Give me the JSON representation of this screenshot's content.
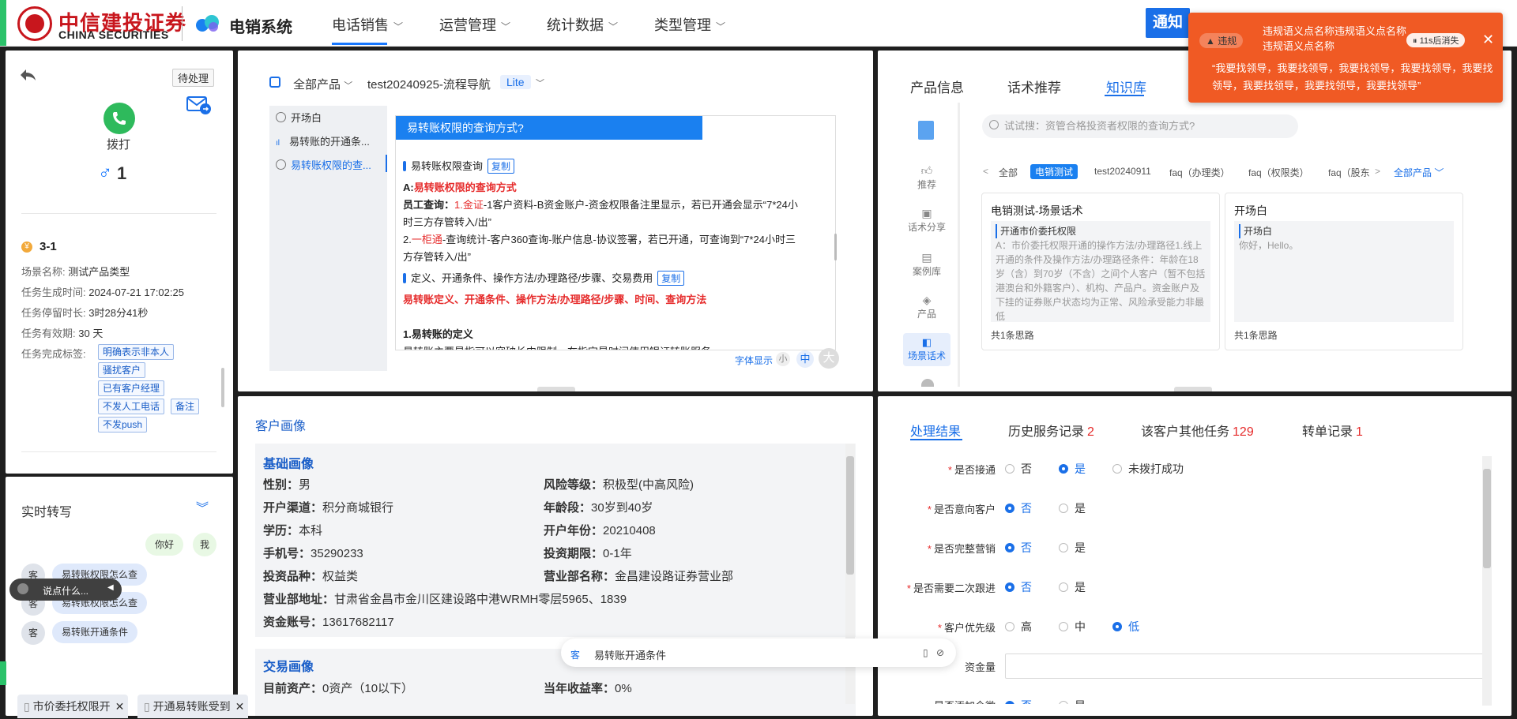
{
  "header": {
    "logo_cn": "中信建投证券",
    "logo_en": "CHINA SECURITIES",
    "system_name": "电销系统",
    "nav": [
      "电话销售",
      "运营管理",
      "统计数据",
      "类型管理"
    ],
    "notice_button": "通知"
  },
  "toast": {
    "badge": "违规",
    "title": "违规语义点名称违规语义点名称违规语义点名称",
    "timer": "11s后消失",
    "body": "“我要找领导，我要找领导，我要找领导，我要找领导，我要找领导，我要找领导，我要找领导，我要找领导”"
  },
  "customer_panel": {
    "pending_button": "待处理",
    "dial_label": "拨打",
    "gender_symbol": "♂",
    "count": "1",
    "task_id": "3-1",
    "fields": [
      {
        "label": "场景名称:",
        "value": "测试产品类型"
      },
      {
        "label": "任务生成时间:",
        "value": "2024-07-21 17:02:25"
      },
      {
        "label": "任务停留时长:",
        "value": "3时28分41秒"
      },
      {
        "label": "任务有效期:",
        "value": "30 天"
      },
      {
        "label": "任务完成标签:",
        "value": ""
      }
    ],
    "tags": [
      "明确表示非本人",
      "骚扰客户",
      "已有客户经理",
      "不发人工电话",
      "备注",
      "不发push"
    ]
  },
  "realtime": {
    "title": "实时转写",
    "messages": [
      {
        "side": "agent",
        "text": "你好",
        "avatar": "我"
      },
      {
        "side": "customer",
        "text": "易转账权限怎么查",
        "avatar": "客"
      },
      {
        "side": "customer",
        "text": "易转账权限怎么查",
        "avatar": "客"
      },
      {
        "side": "customer",
        "text": "易转账开通条件",
        "avatar": "客"
      }
    ],
    "voice_placeholder": "说点什么..."
  },
  "script_panel": {
    "product_select": "全部产品",
    "flow_name": "test20240925-流程导航",
    "lite_badge": "Lite",
    "flow_items": [
      "开场白",
      "易转账的开通条...",
      "易转账权限的查..."
    ],
    "content_title": "易转账权限的查询方式?",
    "section1_title": "易转账权限查询",
    "copy_label": "复制",
    "answer_head_prefix": "A:",
    "answer_head": "易转账权限的查询方式",
    "line1_label": "员工查询：",
    "line1_num": "1.",
    "line1_red": "金证",
    "line1_rest": "-1客户资料-B资金账户-资金权限备注里显示，若已开通会显示“7*24小",
    "line1_cont": "时三方存管转入/出”",
    "line2_num": "2.",
    "line2_red": "一柜通",
    "line2_rest": "-查询统计-客户360查询-账户信息-协议签署，若已开通，可查询到“7*24小时三",
    "line2_cont": "方存管转入/出”",
    "section2_title": "定义、开通条件、操作方法/办理路径/步骤、交易费用",
    "section2_red": "易转账定义、开通条件、操作方法/办理路径/步骤、时间、查询方法",
    "sub_heading": "1.易转账的定义",
    "sub_text": "易转账主要是指可以突破长中限制，在指定是时间使用银证转账服务",
    "font_size_label": "字体显示",
    "font_sizes": [
      "小",
      "中",
      "大"
    ]
  },
  "knowledge_panel": {
    "tabs": [
      "产品信息",
      "话术推荐",
      "知识库"
    ],
    "side_items": [
      "推荐",
      "话术分享",
      "案例库",
      "产品",
      "场景话术"
    ],
    "search_placeholder": "试试搜：资管合格投资者权限的查询方式?",
    "categories": [
      "全部",
      "电销测试",
      "test20240911",
      "faq（办理类）",
      "faq（权限类）",
      "faq（股东"
    ],
    "all_products": "全部产品",
    "cards": [
      {
        "title": "电销测试-场景话术",
        "sub": "开通市价委托权限",
        "body": "A：市价委托权限开通的操作方法/办理路径1.线上开通的条件及操作方法/办理路径条件：年龄在18岁（含）到70岁（不含）之间个人客户（暂不包括港澳台和外籍客户）、机构、产品户。资金账户及下挂的证券账户状态均为正常、风险承受能力非最低",
        "foot": "共1条思路"
      },
      {
        "title": "开场白",
        "sub": "开场白",
        "body": "你好，Hello。",
        "foot": "共1条思路"
      }
    ]
  },
  "portrait": {
    "title": "客户画像",
    "basic_title": "基础画像",
    "basic_left": [
      {
        "k": "性别：",
        "v": "男"
      },
      {
        "k": "开户渠道：",
        "v": "积分商城银行"
      },
      {
        "k": "学历：",
        "v": "本科"
      },
      {
        "k": "手机号：",
        "v": "35290233"
      },
      {
        "k": "投资品种：",
        "v": "权益类"
      },
      {
        "k": "营业部地址：",
        "v": "甘肃省金昌市金川区建设路中港WRMH零层5965、1839"
      },
      {
        "k": "资金账号：",
        "v": "13617682117"
      }
    ],
    "basic_right": [
      {
        "k": "风险等级：",
        "v": "积极型(中高风险)"
      },
      {
        "k": "年龄段：",
        "v": "30岁到40岁"
      },
      {
        "k": "开户年份：",
        "v": "20210408"
      },
      {
        "k": "投资期限：",
        "v": "0-1年"
      },
      {
        "k": "营业部名称：",
        "v": "金昌建设路证券营业部"
      }
    ],
    "trade_title": "交易画像",
    "trade_left": {
      "k": "目前资产：",
      "v": "0资产（10以下）"
    },
    "trade_right": {
      "k": "当年收益率：",
      "v": "0%"
    }
  },
  "floating_bar": {
    "avatar": "客",
    "text": "易转账开通条件"
  },
  "result_panel": {
    "tabs": [
      {
        "label": "处理结果",
        "count": ""
      },
      {
        "label": "历史服务记录",
        "count": "2"
      },
      {
        "label": "该客户其他任务",
        "count": "129"
      },
      {
        "label": "转单记录",
        "count": "1"
      }
    ],
    "questions": [
      {
        "label": "是否接通",
        "options": [
          "否",
          "是",
          "未拨打成功"
        ],
        "selected": 1
      },
      {
        "label": "是否意向客户",
        "options": [
          "否",
          "是"
        ],
        "selected": 0
      },
      {
        "label": "是否完整营销",
        "options": [
          "否",
          "是"
        ],
        "selected": 0
      },
      {
        "label": "是否需要二次跟进",
        "options": [
          "否",
          "是"
        ],
        "selected": 0
      },
      {
        "label": "客户优先级",
        "options": [
          "高",
          "中",
          "低"
        ],
        "selected": 2
      }
    ],
    "capital_label": "资金量",
    "cut_label": "是否添加企微",
    "cut_options": [
      "否",
      "是"
    ]
  },
  "bottom_tabs": [
    "市价委托权限开",
    "开通易转账受到"
  ],
  "colors": {
    "accent": "#1a6fe8",
    "brand_red": "#c8161d",
    "toast": "#f05a24",
    "dial": "#2eba5c"
  }
}
